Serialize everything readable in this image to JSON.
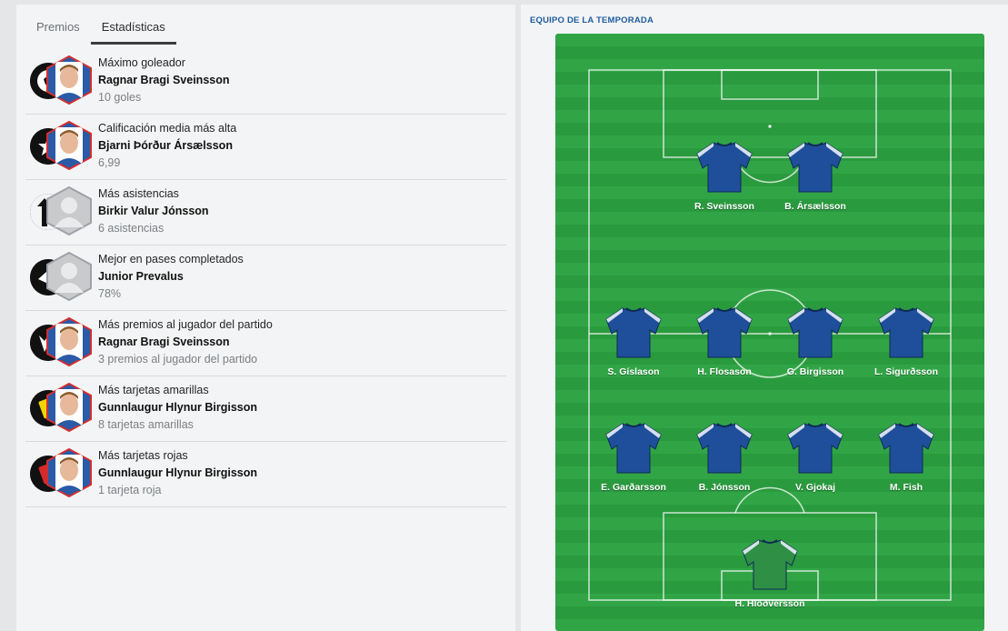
{
  "tabs": [
    {
      "label": "Premios",
      "active": false
    },
    {
      "label": "Estadísticas",
      "active": true
    }
  ],
  "stats": [
    {
      "label": "Máximo goleador",
      "player": "Ragnar Bragi Sveinsson",
      "value": "10 goles",
      "icon": "ball-icon",
      "portrait": "player-photo"
    },
    {
      "label": "Calificación media más alta",
      "player": "Bjarni Þórður Ársælsson",
      "value": "6,99",
      "icon": "star-icon",
      "portrait": "player-photo"
    },
    {
      "label": "Más asistencias",
      "player": "Birkir Valur Jónsson",
      "value": "6 asistencias",
      "icon": "assist-arrow-icon",
      "portrait": "silhouette"
    },
    {
      "label": "Mejor en pases completados",
      "player": "Junior Prevalus",
      "value": "78%",
      "icon": "pass-icon",
      "portrait": "silhouette"
    },
    {
      "label": "Más premios al jugador del partido",
      "player": "Ragnar Bragi Sveinsson",
      "value": "3 premios al jugador del partido",
      "icon": "trophy-icon",
      "portrait": "player-photo"
    },
    {
      "label": "Más tarjetas amarillas",
      "player": "Gunnlaugur Hlynur Birgisson",
      "value": "8 tarjetas amarillas",
      "icon": "yellow-card-icon",
      "portrait": "player-photo"
    },
    {
      "label": "Más tarjetas rojas",
      "player": "Gunnlaugur Hlynur Birgisson",
      "value": "1 tarjeta roja",
      "icon": "red-card-icon",
      "portrait": "player-photo"
    }
  ],
  "team_of_season": {
    "title": "EQUIPO DE LA TEMPORADA",
    "shirt_color": "#1f4f9a",
    "keeper_color": "#2f8f45",
    "strikers": [
      "R. Sveinsson",
      "B. Ársælsson"
    ],
    "midfielders": [
      "S. Gíslason",
      "H. Flosason",
      "G. Birgisson",
      "L. Sigurðsson"
    ],
    "defenders": [
      "E. Garðarsson",
      "B. Jónsson",
      "V. Gjokaj",
      "M. Fish"
    ],
    "goalkeeper": "H. Hlöðversson"
  }
}
